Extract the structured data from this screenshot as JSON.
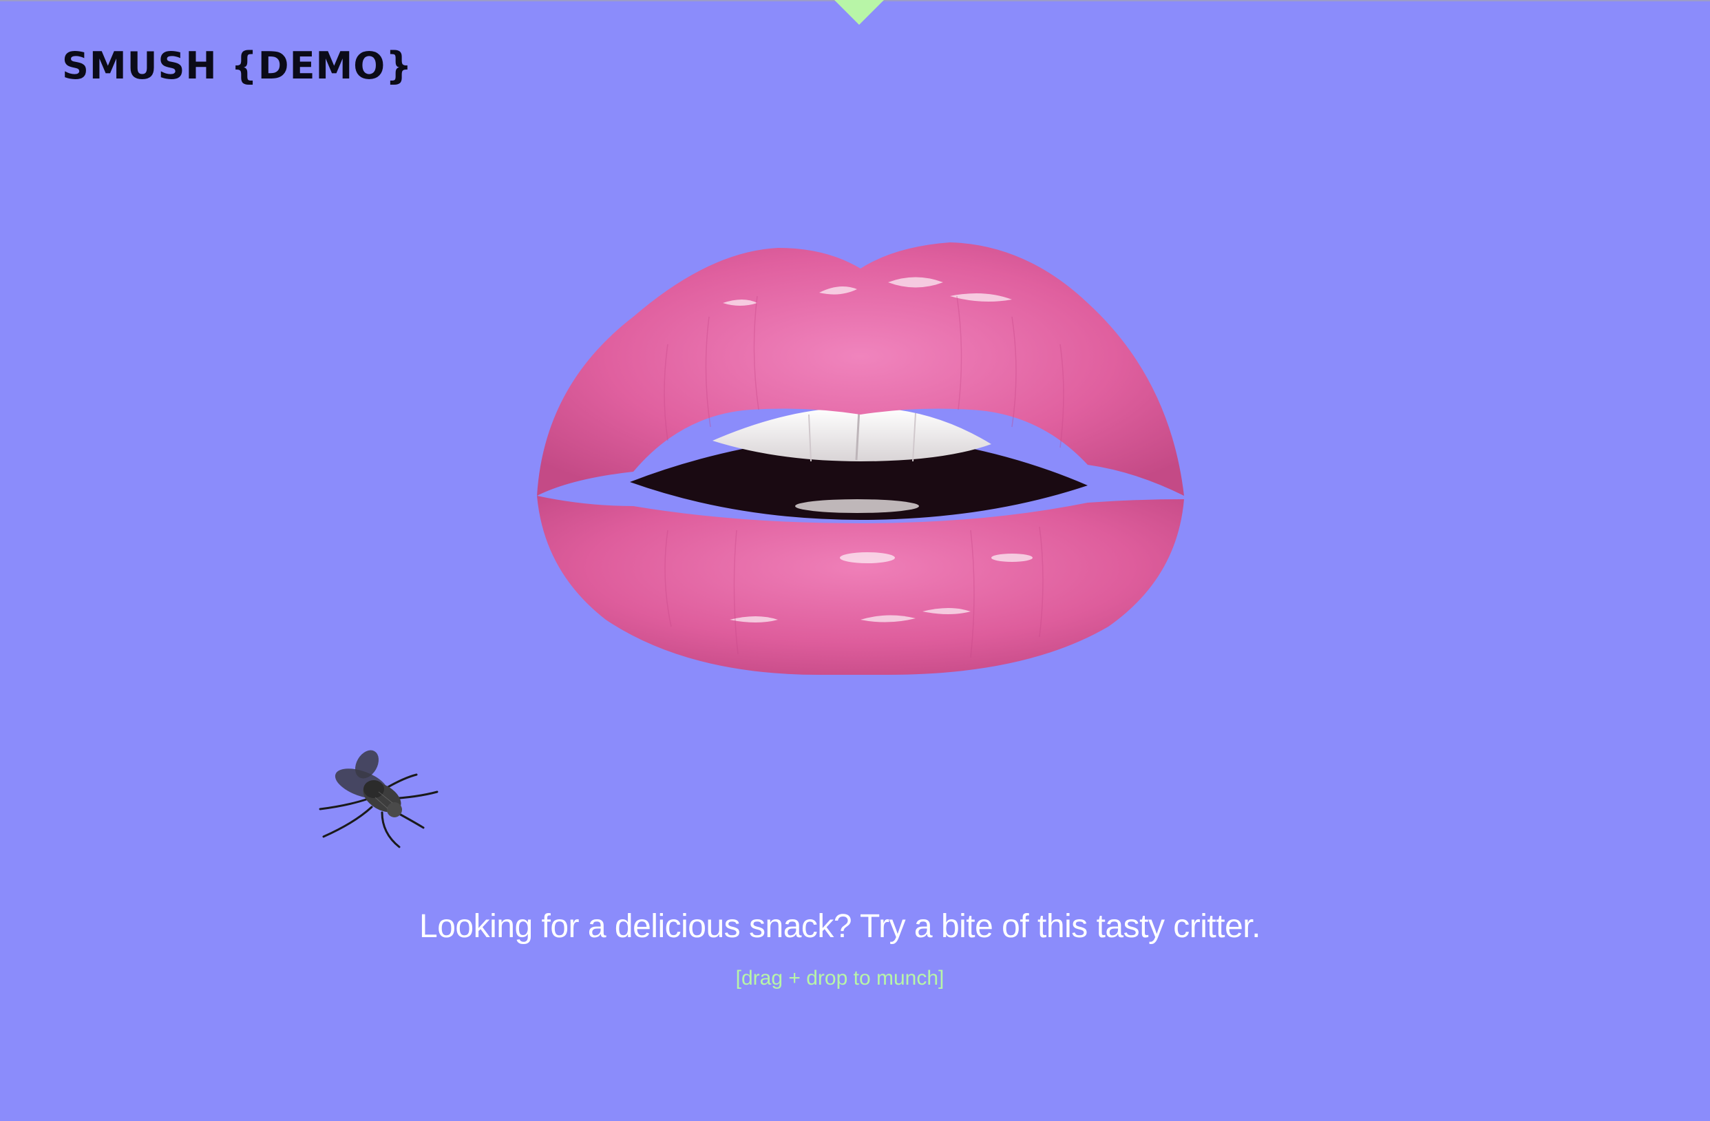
{
  "header": {
    "logo_text": "SMUSH {DEMO}"
  },
  "drawer": {
    "toggle_icon": "triangle-down-icon",
    "color": "#b8f5a7"
  },
  "scene": {
    "mouth_image": "glossy-pink-lips",
    "snack_image": "housefly",
    "tagline": "Looking for a delicious snack? Try a bite of this tasty critter.",
    "hint": "[drag + drop to munch]"
  },
  "colors": {
    "background": "#8b8cfb",
    "accent": "#b8f5a7",
    "lip": "#e0609f",
    "text": "#ffffff"
  }
}
